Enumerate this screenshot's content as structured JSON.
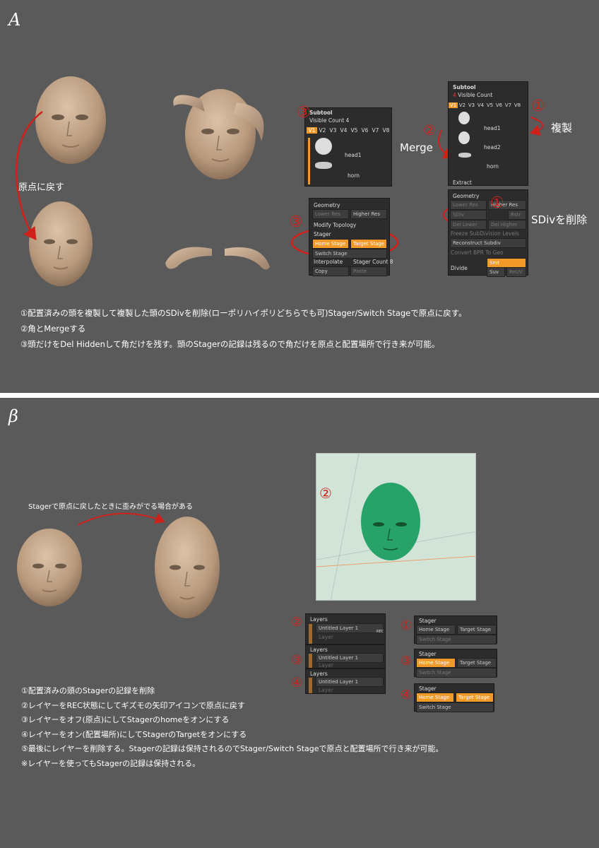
{
  "sectionA": {
    "letter": "A",
    "origin_label": "原点に戻す",
    "subtool_panel_left": {
      "title": "Subtool",
      "visible_count": "Visible Count 4",
      "tabs": [
        "V1",
        "V2",
        "V3",
        "V4",
        "V5",
        "V6",
        "V7",
        "V8"
      ],
      "items": [
        "head1",
        "horn"
      ]
    },
    "subtool_panel_right": {
      "title": "Subtool",
      "visible_count_num": "4",
      "visible_count_label": "Visible Count",
      "tabs": [
        "V1",
        "V2",
        "V3",
        "V4",
        "V5",
        "V6",
        "V7",
        "V8"
      ],
      "items": [
        "head1",
        "head2",
        "horn"
      ],
      "extract": "Extract"
    },
    "geometry_panel_left": {
      "title": "Geometry",
      "lower_res": "Lower Res",
      "higher_res": "Higher Res",
      "modify_topology": "Modify Topology",
      "stager": "Stager",
      "home_stage": "Home Stage",
      "target_stage": "Target Stage",
      "switch_stage": "Switch Stage",
      "interpolate": "Interpolate",
      "stager_count": "Stager Count 8",
      "copy": "Copy",
      "paste": "Paste"
    },
    "geometry_panel_right": {
      "title": "Geometry",
      "lower_res": "Lower Res",
      "higher_res": "Higher Res",
      "sdiv": "SDiv",
      "rstr": "Rstr",
      "del_lower": "Del Lower",
      "del_higher": "Del Higher",
      "freeze": "Freeze SubDivision Levels",
      "reconstruct": "Reconstruct Subdiv",
      "convert": "Convert BPR To Geo",
      "divide": "Divide",
      "smt": "Smt",
      "suv": "Suv",
      "reuv": "ReUV"
    },
    "labels": {
      "merge": "Merge",
      "duplicate": "複製",
      "sdiv_delete": "SDivを削除"
    },
    "markers": {
      "m1": "①",
      "m2": "②",
      "m3a": "③",
      "m3b": "③",
      "m1b": "①"
    },
    "notes": [
      "①配置済みの頭を複製して複製した頭のSDivを削除(ローポリハイポリどちらでも可)Stager/Switch Stageで原点に戻す。",
      "②角とMergeする",
      "③頭だけをDel Hiddenして角だけを残す。頭のStagerの記録は残るので角だけを原点と配置場所で行き来が可能。"
    ]
  },
  "sectionB": {
    "letter": "β",
    "distortion_label": "Stagerで原点に戻したときに歪みがでる場合がある",
    "viewport_marker": "②",
    "layers_panels": [
      {
        "title": "Layers",
        "layer": "Untitled Layer 1",
        "sub": "Layer",
        "rec": "REC",
        "marker": "②"
      },
      {
        "title": "Layers",
        "layer": "Untitled Layer 1",
        "sub": "Layer",
        "marker": "③"
      },
      {
        "title": "Layers",
        "layer": "Untitled Layer 1",
        "sub": "Layer",
        "marker": "④"
      }
    ],
    "stager_panels": [
      {
        "title": "Stager",
        "home": "Home Stage",
        "target": "Target Stage",
        "switch": "Switch Stage",
        "marker": "①",
        "home_on": false,
        "target_on": false
      },
      {
        "title": "Stager",
        "home": "Home Stage",
        "target": "Target Stage",
        "switch": "Switch Stage",
        "marker": "③",
        "home_on": true,
        "target_on": false
      },
      {
        "title": "Stager",
        "home": "Home Stage",
        "target": "Target Stage",
        "switch": "Switch Stage",
        "marker": "④",
        "home_on": true,
        "target_on": true
      }
    ],
    "notes": [
      "①配置済みの頭のStagerの記録を削除",
      "②レイヤーをREC状態にしてギズモの矢印アイコンで原点に戻す",
      "③レイヤーをオフ(原点)にしてStagerのhomeをオンにする",
      "④レイヤーをオン(配置場所)にしてStagerのTargetをオンにする",
      "⑤最後にレイヤーを削除する。Stagerの記録は保持されるのでStager/Switch Stageで原点と配置場所で行き来が可能。",
      "※レイヤーを使ってもStagerの記録は保持される。"
    ]
  },
  "colors": {
    "background": "#5a5a5a",
    "panel": "#2c2c2c",
    "accent": "#f19a29",
    "annotation": "#d0201a",
    "head": "#c5a98e",
    "mesh": "#27a36a"
  }
}
